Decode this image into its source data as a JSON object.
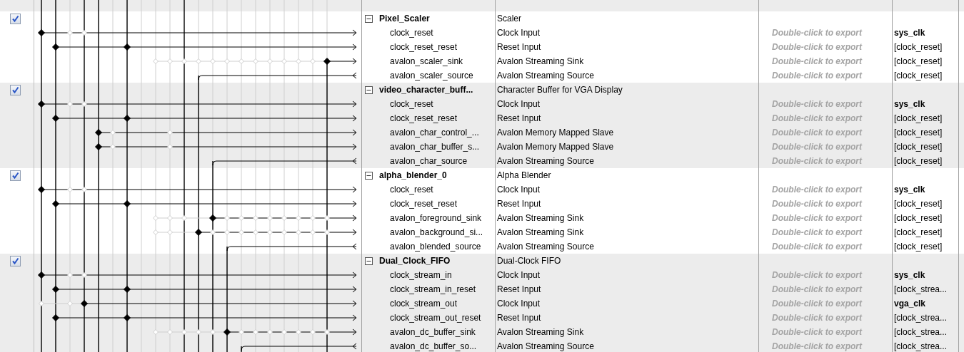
{
  "modules": [
    {
      "name": "Pixel_Scaler",
      "description": "Scaler",
      "enabled": true,
      "expanded": true,
      "ports": [
        {
          "name": "clock_reset",
          "description": "Clock Input",
          "outgoing": false,
          "export": "Double-click to export",
          "connection": "sys_clk",
          "clock": true
        },
        {
          "name": "clock_reset_reset",
          "description": "Reset Input",
          "outgoing": false,
          "export": "Double-click to export",
          "connection": "[clock_reset]",
          "clock": false
        },
        {
          "name": "avalon_scaler_sink",
          "description": "Avalon Streaming Sink",
          "outgoing": false,
          "export": "Double-click to export",
          "connection": "[clock_reset]",
          "clock": false
        },
        {
          "name": "avalon_scaler_source",
          "description": "Avalon Streaming Source",
          "outgoing": true,
          "export": "Double-click to export",
          "connection": "[clock_reset]",
          "clock": false
        }
      ]
    },
    {
      "name": "video_character_buff...",
      "description": "Character Buffer for VGA Display",
      "enabled": true,
      "expanded": true,
      "ports": [
        {
          "name": "clock_reset",
          "description": "Clock Input",
          "outgoing": false,
          "export": "Double-click to export",
          "connection": "sys_clk",
          "clock": true
        },
        {
          "name": "clock_reset_reset",
          "description": "Reset Input",
          "outgoing": false,
          "export": "Double-click to export",
          "connection": "[clock_reset]",
          "clock": false
        },
        {
          "name": "avalon_char_control_...",
          "description": "Avalon Memory Mapped Slave",
          "outgoing": false,
          "export": "Double-click to export",
          "connection": "[clock_reset]",
          "clock": false
        },
        {
          "name": "avalon_char_buffer_s...",
          "description": "Avalon Memory Mapped Slave",
          "outgoing": false,
          "export": "Double-click to export",
          "connection": "[clock_reset]",
          "clock": false
        },
        {
          "name": "avalon_char_source",
          "description": "Avalon Streaming Source",
          "outgoing": true,
          "export": "Double-click to export",
          "connection": "[clock_reset]",
          "clock": false
        }
      ]
    },
    {
      "name": "alpha_blender_0",
      "description": "Alpha Blender",
      "enabled": true,
      "expanded": true,
      "ports": [
        {
          "name": "clock_reset",
          "description": "Clock Input",
          "outgoing": false,
          "export": "Double-click to export",
          "connection": "sys_clk",
          "clock": true
        },
        {
          "name": "clock_reset_reset",
          "description": "Reset Input",
          "outgoing": false,
          "export": "Double-click to export",
          "connection": "[clock_reset]",
          "clock": false
        },
        {
          "name": "avalon_foreground_sink",
          "description": "Avalon Streaming Sink",
          "outgoing": false,
          "export": "Double-click to export",
          "connection": "[clock_reset]",
          "clock": false
        },
        {
          "name": "avalon_background_si...",
          "description": "Avalon Streaming Sink",
          "outgoing": false,
          "export": "Double-click to export",
          "connection": "[clock_reset]",
          "clock": false
        },
        {
          "name": "avalon_blended_source",
          "description": "Avalon Streaming Source",
          "outgoing": true,
          "export": "Double-click to export",
          "connection": "[clock_reset]",
          "clock": false
        }
      ]
    },
    {
      "name": "Dual_Clock_FIFO",
      "description": "Dual-Clock FIFO",
      "enabled": true,
      "expanded": true,
      "ports": [
        {
          "name": "clock_stream_in",
          "description": "Clock Input",
          "outgoing": false,
          "export": "Double-click to export",
          "connection": "sys_clk",
          "clock": true
        },
        {
          "name": "clock_stream_in_reset",
          "description": "Reset Input",
          "outgoing": false,
          "export": "Double-click to export",
          "connection": "[clock_strea...",
          "clock": false
        },
        {
          "name": "clock_stream_out",
          "description": "Clock Input",
          "outgoing": false,
          "export": "Double-click to export",
          "connection": "vga_clk",
          "clock": true
        },
        {
          "name": "clock_stream_out_reset",
          "description": "Reset Input",
          "outgoing": false,
          "export": "Double-click to export",
          "connection": "[clock_strea...",
          "clock": false
        },
        {
          "name": "avalon_dc_buffer_sink",
          "description": "Avalon Streaming Sink",
          "outgoing": false,
          "export": "Double-click to export",
          "connection": "[clock_strea...",
          "clock": false
        },
        {
          "name": "avalon_dc_buffer_so...",
          "description": "Avalon Streaming Source",
          "outgoing": true,
          "export": "Double-click to export",
          "connection": "[clock_strea...",
          "clock": false
        }
      ]
    }
  ]
}
